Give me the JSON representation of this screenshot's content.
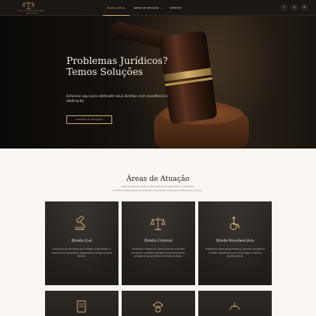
{
  "nav": {
    "logo_text": "CARLOS F. PINTO ADVOGADOS",
    "logo_sub": "ADVOCACIA",
    "items": [
      {
        "label": "PÁGINA INICIAL",
        "active": true
      },
      {
        "label": "ÁREAS DE ATUAÇÃO",
        "caret": "⌄"
      },
      {
        "label": "CONTATO"
      }
    ],
    "social": [
      {
        "icon": "facebook-icon",
        "glyph": "f"
      },
      {
        "icon": "instagram-icon",
        "glyph": "◎"
      },
      {
        "icon": "whatsapp-icon",
        "glyph": "✆"
      }
    ]
  },
  "hero": {
    "title_line1": "Problemas Jurídicos?",
    "title_line2": "Temos Soluções",
    "subtitle": "Estamos aqui para defender seus direitos com excelência e dedicação.",
    "button_label": "Contrate um Advogado"
  },
  "areas": {
    "title": "Áreas de Atuação",
    "subtitle_line1": "Está buscando ajuda e não sabe como encontrar o caminho?",
    "subtitle_line2": "Confira nossas áreas de atuação e encontre a solução jurídica que procura.",
    "cards": [
      {
        "title": "Direito Civil",
        "icon": "gavel-icon",
        "text": "Solucionamos demandas de contratos, indenizações, e disputas de propriedades, assegurando a defesa de seus direitos."
      },
      {
        "title": "Direito Criminal",
        "icon": "scales-icon",
        "text": "Oferecemos defesa em ações criminais, incluindo acusações, inquéritos policiais e processos penais, protegendo seus direitos em todas as etapas."
      },
      {
        "title": "Direito Previdenciário",
        "icon": "wheelchair-icon",
        "text": "Orientamos sobre aposentadorias, pensões e benefícios do INSS, lutando para que você receba os direitos previdenciários."
      }
    ],
    "lower_cards": [
      {
        "icon": "contract-icon"
      },
      {
        "icon": "police-icon"
      },
      {
        "icon": "hands-icon"
      }
    ]
  },
  "colors": {
    "gold": "#c9a56a",
    "dark": "#1a1714",
    "cream": "#faf7f2"
  }
}
